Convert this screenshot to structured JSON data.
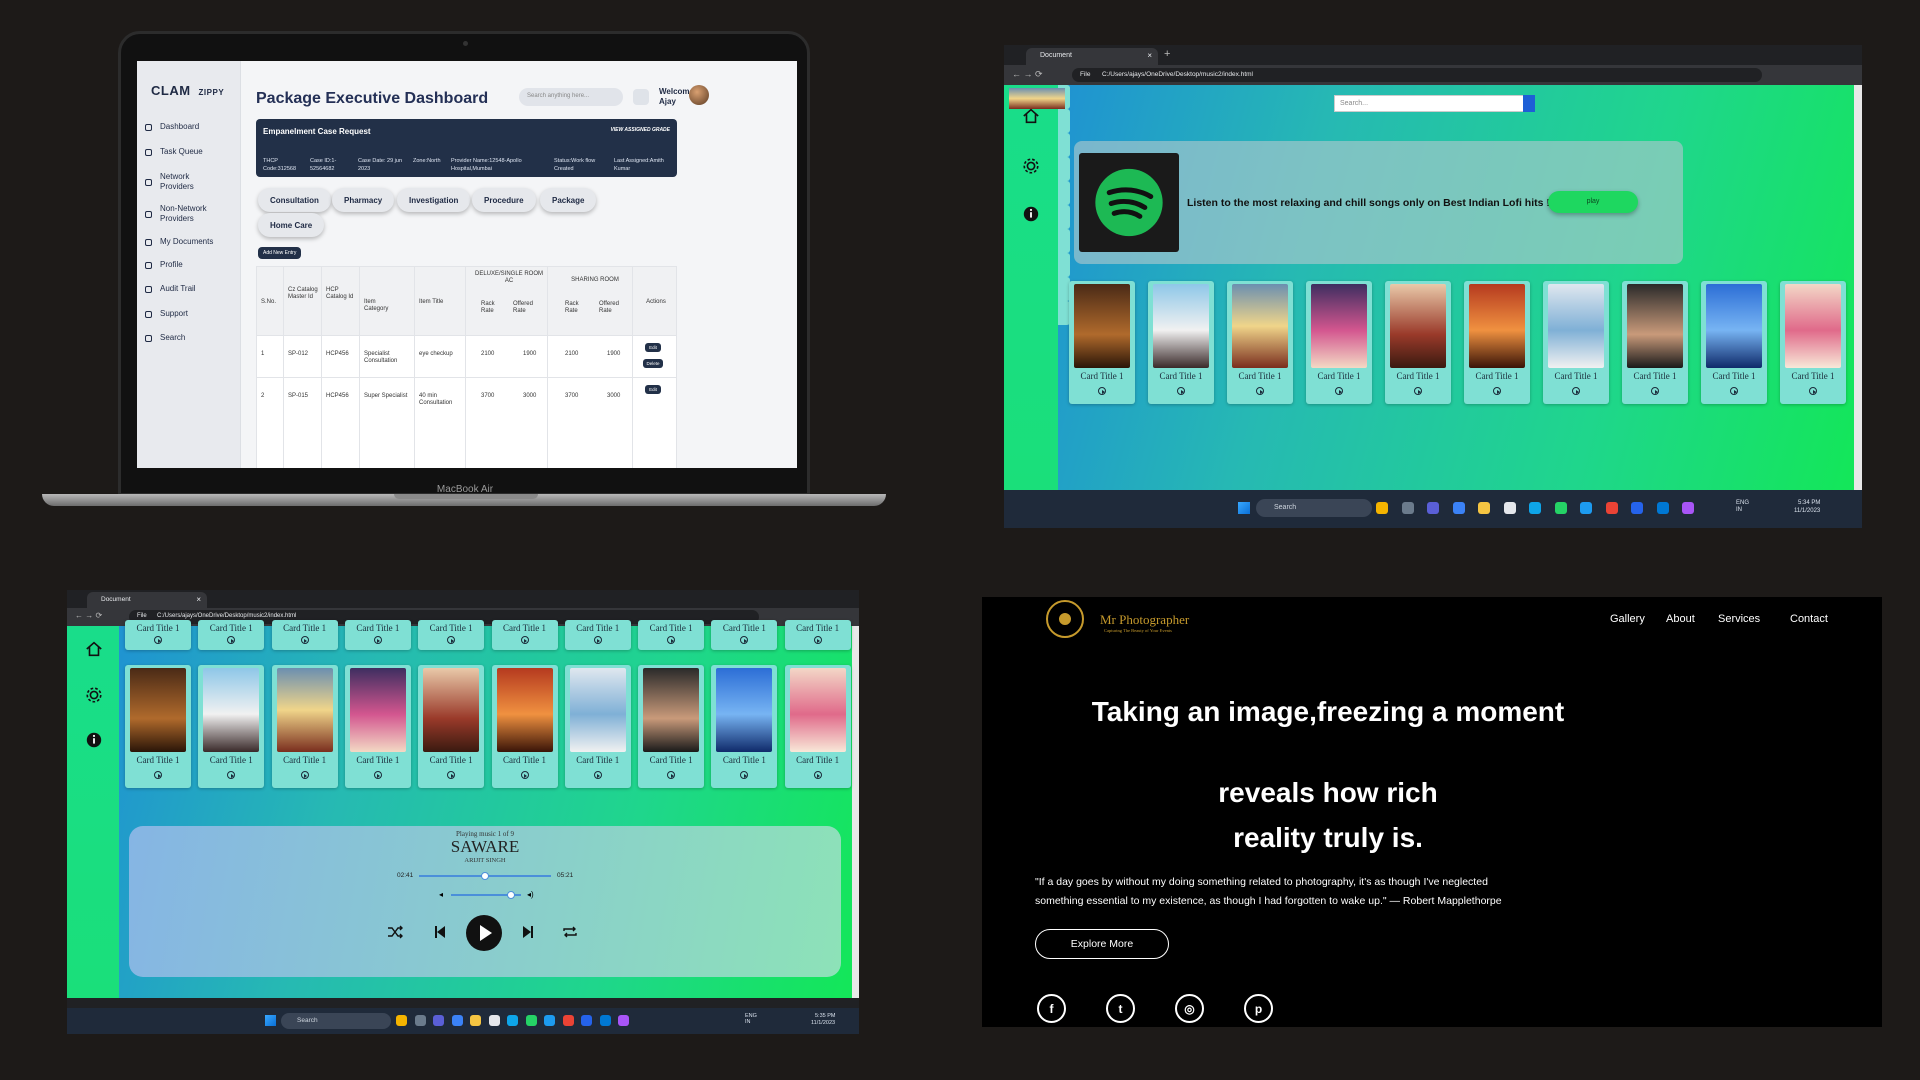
{
  "laptop": {
    "device_label": "MacBook Air",
    "logo": "CLAM",
    "logo_sub": "ZIPPY",
    "title": "Package Executive Dashboard",
    "search_placeholder": "Search anything here...",
    "welcome": "Welcome Ajay",
    "nav": [
      "Dashboard",
      "Task Queue",
      "Network Providers",
      "Non-Network Providers",
      "My Documents",
      "Profile",
      "Audit Trail",
      "Support",
      "Search"
    ],
    "case": {
      "title": "Empanelment Case Request",
      "grade_link": "VIEW ASSIGNED GRADE",
      "fields": [
        "THCP Code:312568",
        "Case ID:1-52564682",
        "Case Date: 29 jun 2023",
        "Zone:North",
        "Provider Name:12548-Apollo Hospital,Mumbai",
        "Status:Work flow Created",
        "Last Assigned:Amith Kumar"
      ]
    },
    "tabs": [
      "Consultation",
      "Pharmacy",
      "Investigation",
      "Procedure",
      "Package",
      "Home Care"
    ],
    "add_button": "Add New Entry",
    "table": {
      "headers": [
        "S.No.",
        "Cz Catalog Master Id",
        "HCP Catalog Id",
        "Item Category",
        "Item Title",
        "DELUXE/SINGLE ROOM AC",
        "SHARING ROOM",
        "Actions"
      ],
      "subheaders": [
        "Rack Rate",
        "Offered Rate",
        "Rack Rate",
        "Offered Rate"
      ],
      "rows": [
        [
          "1",
          "SP-012",
          "HCP456",
          "Specialist Consultation",
          "eye checkup",
          "2100",
          "1900",
          "2100",
          "1900"
        ],
        [
          "2",
          "SP-015",
          "HCP456",
          "Super Specialist",
          "40 min Consultation",
          "3700",
          "3000",
          "3700",
          "3000"
        ]
      ],
      "edit": "Edit",
      "delete": "Delete"
    }
  },
  "browser_top": {
    "tab_title": "Document",
    "file_label": "File",
    "url": "C:/Users/ajays/OneDrive/Desktop/music2/index.html",
    "search_placeholder": "Search...",
    "banner_text": "Listen to the most relaxing and chill songs only on Best Indian Lofi hits !",
    "play_button": "play",
    "card_title": "Card Title 1",
    "taskbar_search": "Search",
    "lang": "ENG IN",
    "time": "5:34 PM",
    "date": "11/1/2023"
  },
  "browser_bottom": {
    "tab_title": "Document",
    "file_label": "File",
    "url": "C:/Users/ajays/OneDrive/Desktop/music2/index.html",
    "card_title": "Card Title 1",
    "player": {
      "status": "Playing music 1 of 9",
      "song": "SAWARE",
      "artist": "ARIJIT SINGH",
      "current_time": "02:41",
      "duration": "05:21",
      "progress": 0.5,
      "volume": 0.85
    },
    "taskbar_search": "Search",
    "lang": "ENG IN",
    "time": "5:35 PM",
    "date": "11/1/2023"
  },
  "photographer": {
    "brand": "Mr Photographer",
    "tagline": "Capturing The Beauty of Your Events",
    "nav": [
      "Gallery",
      "About",
      "Services",
      "Contact"
    ],
    "headline1": "Taking an image,freezing a moment",
    "headline2": "reveals how rich reality truly is.",
    "quote": "\"If a day goes by without my doing something related to photography, it's as though I've neglected something essential to my existence, as though I had forgotten to wake up.\" — Robert Mapplethorpe",
    "cta": "Explore More",
    "social_icons": [
      "facebook-icon",
      "twitter-icon",
      "instagram-icon",
      "pinterest-icon"
    ]
  },
  "colors": {
    "page_bg": "#1d1a18",
    "dashboard_navy": "#223048",
    "music_gradient_start": "#1e8bd8",
    "music_gradient_end": "#13e757",
    "play_green": "#1ed760",
    "spotify_green": "#1db954"
  }
}
